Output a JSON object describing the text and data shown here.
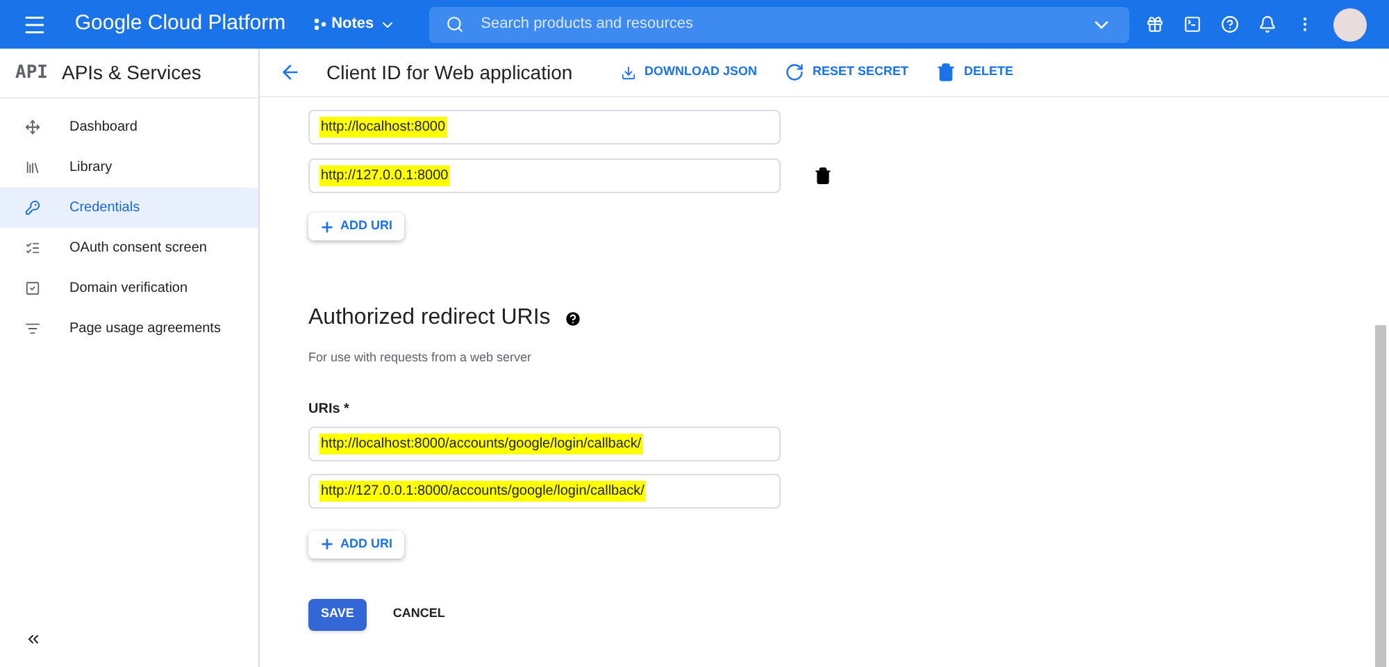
{
  "topbar": {
    "product": "Google Cloud Platform",
    "project": "Notes",
    "search": {
      "placeholder": "Search products and resources"
    }
  },
  "sidebar": {
    "logo": "API",
    "title": "APIs & Services",
    "items": [
      {
        "label": "Dashboard",
        "selected": false
      },
      {
        "label": "Library",
        "selected": false
      },
      {
        "label": "Credentials",
        "selected": true
      },
      {
        "label": "OAuth consent screen",
        "selected": false
      },
      {
        "label": "Domain verification",
        "selected": false
      },
      {
        "label": "Page usage agreements",
        "selected": false
      }
    ]
  },
  "header": {
    "title": "Client ID for Web application",
    "actions": [
      {
        "label": "DOWNLOAD JSON"
      },
      {
        "label": "RESET SECRET"
      },
      {
        "label": "DELETE"
      }
    ]
  },
  "origins": {
    "uris": [
      {
        "value": "http://localhost:8000",
        "highlighted": true,
        "deletable": false
      },
      {
        "value": "http://127.0.0.1:8000",
        "highlighted": true,
        "deletable": true
      }
    ],
    "add_button": "ADD URI"
  },
  "redirects": {
    "title": "Authorized redirect URIs",
    "subtitle": "For use with requests from a web server",
    "field_label": "URIs *",
    "uris": [
      {
        "value": "http://localhost:8000/accounts/google/login/callback/",
        "highlighted": true,
        "deletable": false
      },
      {
        "value": "http://127.0.0.1:8000/accounts/google/login/callback/",
        "highlighted": true,
        "deletable": false
      }
    ],
    "add_button": "ADD URI"
  },
  "buttons": [
    {
      "label": "SAVE",
      "kind": "primary"
    },
    {
      "label": "CANCEL",
      "kind": "text"
    }
  ]
}
